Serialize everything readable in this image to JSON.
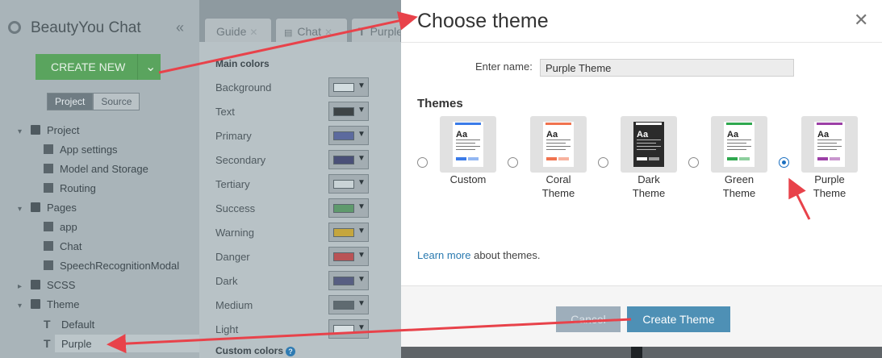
{
  "sidebar": {
    "app_title": "BeautyYou Chat",
    "collapse_glyph": "«",
    "create_label": "CREATE NEW",
    "create_caret": "⌄",
    "toggle": [
      "Project",
      "Source"
    ],
    "tree": [
      {
        "label": "Project",
        "icon": "folder-icon"
      },
      {
        "label": "App settings",
        "icon": "settings-file-icon"
      },
      {
        "label": "Model and Storage",
        "icon": "settings-file-icon"
      },
      {
        "label": "Routing",
        "icon": "settings-file-icon"
      },
      {
        "label": "Pages",
        "icon": "folder-icon"
      },
      {
        "label": "app",
        "icon": "file-icon"
      },
      {
        "label": "Chat",
        "icon": "file-icon"
      },
      {
        "label": "SpeechRecognitionModal",
        "icon": "file-icon"
      },
      {
        "label": "SCSS",
        "icon": "folder-icon"
      },
      {
        "label": "Theme",
        "icon": "folder-icon"
      },
      {
        "label": "Default",
        "icon": "theme-icon"
      },
      {
        "label": "Purple",
        "icon": "theme-icon"
      }
    ]
  },
  "editor_tabs": [
    "Guide",
    "Chat",
    "Purple"
  ],
  "colors_panel": {
    "main_title": "Main colors",
    "rows": [
      {
        "name": "Background",
        "swatch": "#d3dde0"
      },
      {
        "name": "Text",
        "swatch": "#3e4446"
      },
      {
        "name": "Primary",
        "swatch": "#5c6a9e"
      },
      {
        "name": "Secondary",
        "swatch": "#4a5078"
      },
      {
        "name": "Tertiary",
        "swatch": "#c9d3d6"
      },
      {
        "name": "Success",
        "swatch": "#5f9a6d"
      },
      {
        "name": "Warning",
        "swatch": "#c5a63e"
      },
      {
        "name": "Danger",
        "swatch": "#b95356"
      },
      {
        "name": "Dark",
        "swatch": "#575e82"
      },
      {
        "name": "Medium",
        "swatch": "#5f6a70"
      },
      {
        "name": "Light",
        "swatch": "#d8e0e3"
      }
    ],
    "custom_title": "Custom colors",
    "help_glyph": "?"
  },
  "dialog": {
    "title": "Choose theme",
    "close_glyph": "✕",
    "name_label": "Enter name:",
    "name_value": "Purple Theme",
    "themes_heading": "Themes",
    "themes": [
      {
        "label_lines": [
          "Custom",
          ""
        ],
        "accent": "#3b7be8",
        "dark": false,
        "selected": false
      },
      {
        "label_lines": [
          "Coral",
          "Theme"
        ],
        "accent": "#f0734f",
        "dark": false,
        "selected": false
      },
      {
        "label_lines": [
          "Dark Theme",
          ""
        ],
        "accent": "#ffffff",
        "dark": true,
        "selected": false
      },
      {
        "label_lines": [
          "Green",
          "Theme"
        ],
        "accent": "#2fa84f",
        "dark": false,
        "selected": false
      },
      {
        "label_lines": [
          "Purple",
          "Theme"
        ],
        "accent": "#9c3fa6",
        "dark": false,
        "selected": true
      }
    ],
    "learn_link": "Learn more",
    "learn_rest": " about themes.",
    "cancel_label": "Cancel",
    "create_label": "Create Theme"
  },
  "colors": {
    "annotation_arrow": "#e8424a",
    "create_green": "#5aa45e",
    "primary_blue": "#4e90b5"
  }
}
